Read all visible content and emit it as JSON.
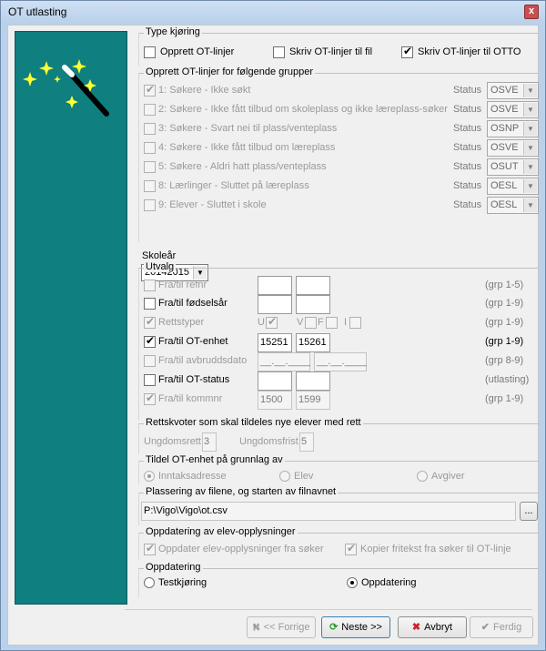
{
  "window": {
    "title": "OT utlasting",
    "close": "x"
  },
  "type_kjoring": {
    "legend": "Type kjøring",
    "opprett": {
      "label": "Opprett OT-linjer",
      "checked": false
    },
    "skriv_fil": {
      "label": "Skriv OT-linjer til fil",
      "checked": false
    },
    "skriv_otto": {
      "label": "Skriv OT-linjer til OTTO",
      "checked": true
    }
  },
  "grupper": {
    "legend": "Opprett OT-linjer for følgende grupper",
    "status_label": "Status",
    "items": [
      {
        "label": "1: Søkere - Ikke søkt",
        "checked": true,
        "status": "OSVE"
      },
      {
        "label": "2: Søkere - Ikke fått tilbud om skoleplass og ikke læreplass-søker",
        "checked": false,
        "status": "OSVE"
      },
      {
        "label": "3: Søkere - Svart nei til plass/venteplass",
        "checked": false,
        "status": "OSNP"
      },
      {
        "label": "4: Søkere - Ikke fått tilbud om læreplass",
        "checked": false,
        "status": "OSVE"
      },
      {
        "label": "5: Søkere - Aldri hatt plass/venteplass",
        "checked": false,
        "status": "OSUT"
      },
      {
        "label": "8: Lærlinger - Sluttet på læreplass",
        "checked": false,
        "status": "OESL"
      },
      {
        "label": "9: Elever - Sluttet i skole",
        "checked": false,
        "status": "OESL"
      }
    ]
  },
  "skolear": {
    "legend": "Skoleår",
    "value": "20142015"
  },
  "utvalg": {
    "legend": "Utvalg",
    "refnr": {
      "label": "Fra/til refnr",
      "from": "",
      "to": "",
      "grp": "(grp 1-5)"
    },
    "fodselsar": {
      "label": "Fra/til fødselsår",
      "from": "",
      "to": "",
      "grp": "(grp 1-9)"
    },
    "rettstyper": {
      "label": "Rettstyper",
      "u": "U",
      "v": "V",
      "f": "F",
      "i": "I",
      "grp": "(grp 1-9)"
    },
    "otenhet": {
      "label": "Fra/til OT-enhet",
      "from": "15251",
      "to": "15261",
      "grp": "(grp 1-9)"
    },
    "avbrudd": {
      "label": "Fra/til avbruddsdato",
      "from": "__.__.____",
      "to": "__.__.____",
      "grp": "(grp 8-9)"
    },
    "otstatus": {
      "label": "Fra/til OT-status",
      "from": "",
      "to": "",
      "grp": "(utlasting)"
    },
    "kommnr": {
      "label": "Fra/til kommnr",
      "from": "1500",
      "to": "1599",
      "grp": "(grp 1-9)"
    }
  },
  "rettskvoter": {
    "legend": "Rettskvoter som skal tildeles nye elever med rett",
    "ungdomsrett_label": "Ungdomsrett",
    "ungdomsrett": "3",
    "ungdomsfrist_label": "Ungdomsfrist",
    "ungdomsfrist": "5"
  },
  "tildel": {
    "legend": "Tildel OT-enhet på grunnlag av",
    "innteksadresse": "Inntaksadresse",
    "elev": "Elev",
    "avgiver": "Avgiver"
  },
  "plassering": {
    "legend": "Plassering av filene, og starten av filnavnet",
    "path": "P:\\Vigo\\Vigo\\ot.csv",
    "browse": "..."
  },
  "oppdatering_elev": {
    "legend": "Oppdatering av elev-opplysninger",
    "fra_soker": "Oppdater elev-opplysninger fra søker",
    "kopier": "Kopier fritekst fra søker til OT-linje"
  },
  "oppdatering": {
    "legend": "Oppdatering",
    "testkjoring": "Testkjøring",
    "oppdatering": "Oppdatering"
  },
  "buttons": {
    "forrige": "<< Forrige",
    "neste": "Neste >>",
    "avbryt": "Avbryt",
    "ferdig": "Ferdig"
  }
}
